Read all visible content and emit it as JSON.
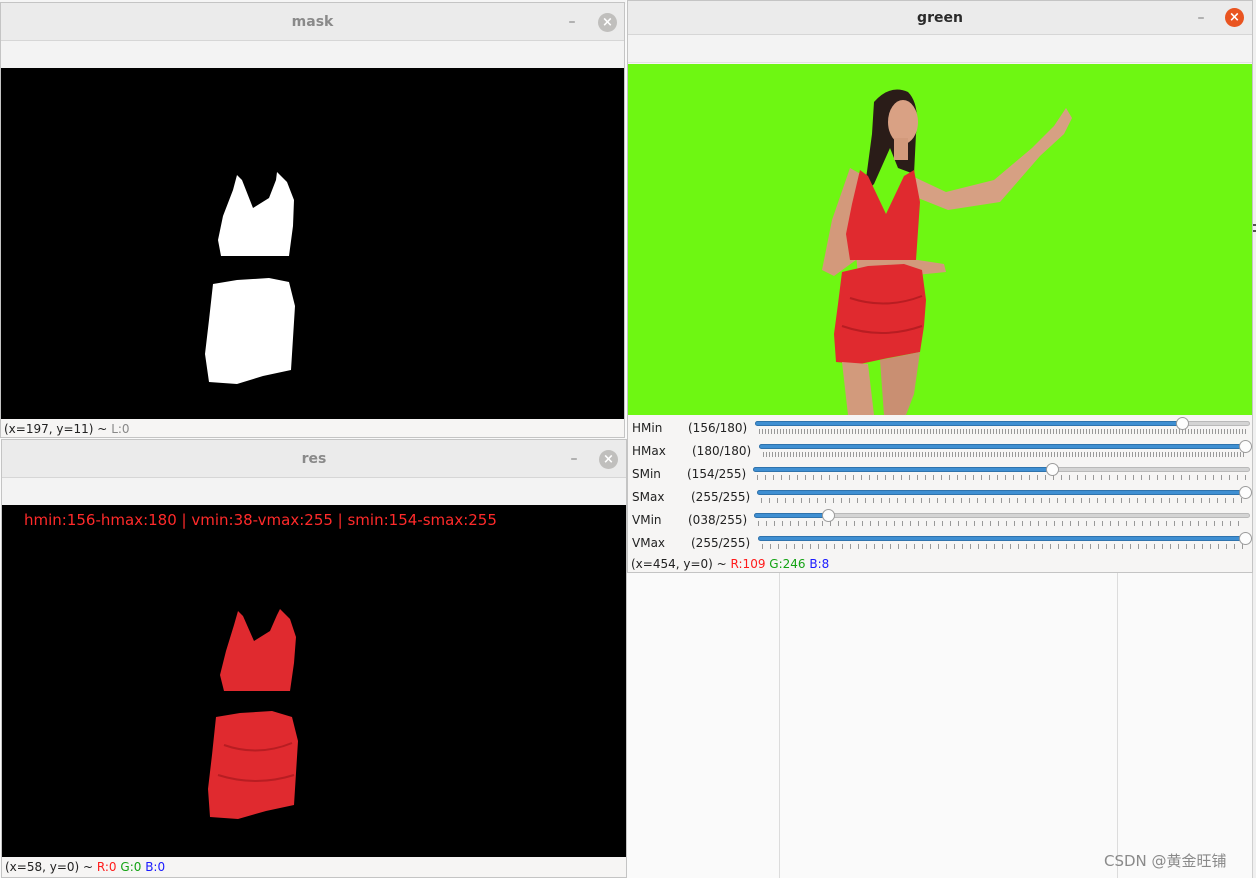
{
  "windows": {
    "mask": {
      "title": "mask",
      "status": {
        "coords": "(x=197, y=11) ~",
        "l": "L:0"
      }
    },
    "res": {
      "title": "res",
      "overlay_text": "hmin:156-hmax:180 | vmin:38-vmax:255 | smin:154-smax:255",
      "status": {
        "coords": "(x=58, y=0) ~",
        "r": "R:0",
        "g": "G:0",
        "b": "B:0"
      }
    },
    "green": {
      "title": "green",
      "trackbars": [
        {
          "name": "HMin",
          "value": "(156/180)",
          "fraction": 0.867
        },
        {
          "name": "HMax",
          "value": "(180/180)",
          "fraction": 1.0
        },
        {
          "name": "SMin",
          "value": "(154/255)",
          "fraction": 0.604
        },
        {
          "name": "SMax",
          "value": "(255/255)",
          "fraction": 1.0
        },
        {
          "name": "VMin",
          "value": "(038/255)",
          "fraction": 0.149
        },
        {
          "name": "VMax",
          "value": "(255/255)",
          "fraction": 1.0
        }
      ],
      "status": {
        "coords": "(x=454, y=0) ~",
        "r": "R:109",
        "g": "G:246",
        "b": "B:8"
      }
    }
  },
  "controls": {
    "minimize": "–",
    "close": "×"
  },
  "watermark": "CSDN @黄金旺铺",
  "colors": {
    "green_screen": "#6ef712",
    "dress": "#e02a2f",
    "accent_close": "#e95420",
    "slider_fill": "#3f8fd2"
  }
}
